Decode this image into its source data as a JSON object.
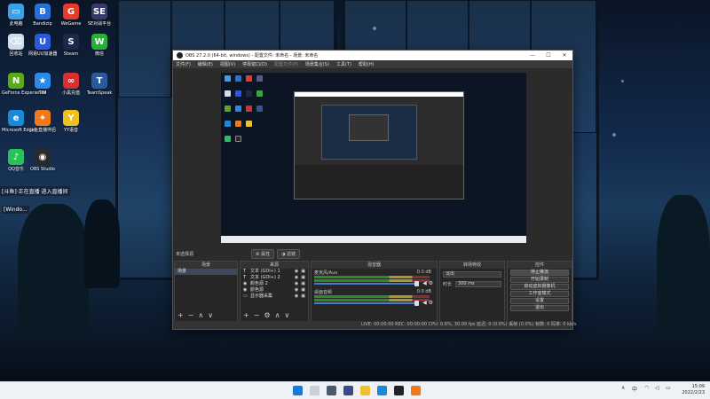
{
  "desktop": {
    "icons": [
      {
        "label": "此电脑",
        "color": "#3ca0e8",
        "glyph": "▭",
        "icon": "computer-icon"
      },
      {
        "label": "Bandizip",
        "color": "#2a6ed8",
        "glyph": "B",
        "icon": "bandizip-icon"
      },
      {
        "label": "WeGame",
        "color": "#e83a2a",
        "glyph": "G",
        "icon": "wegame-icon"
      },
      {
        "label": "SE对战平台",
        "color": "#3a3a6a",
        "glyph": "SE",
        "icon": "se-platform-icon"
      },
      {
        "label": "回收站",
        "color": "#cfdcea",
        "glyph": "⌫",
        "icon": "recycle-bin-icon"
      },
      {
        "label": "网易UU加速器",
        "color": "#2a5ad8",
        "glyph": "U",
        "icon": "uu-icon"
      },
      {
        "label": "Steam",
        "color": "#1b2a4a",
        "glyph": "S",
        "icon": "steam-icon"
      },
      {
        "label": "微信",
        "color": "#2aae3a",
        "glyph": "W",
        "icon": "wechat-icon"
      },
      {
        "label": "GeForce Experience",
        "color": "#5aaa1a",
        "glyph": "N",
        "icon": "geforce-icon"
      },
      {
        "label": "TIM",
        "color": "#2a8ae8",
        "glyph": "★",
        "icon": "tim-icon"
      },
      {
        "label": "小黑充值",
        "color": "#d83030",
        "glyph": "∞",
        "icon": "xiaohei-icon"
      },
      {
        "label": "TeamSpeak",
        "color": "#2a5a9a",
        "glyph": "T",
        "icon": "teamspeak-icon"
      },
      {
        "label": "Microsoft Edge",
        "color": "#1a8ad8",
        "glyph": "e",
        "icon": "edge-icon"
      },
      {
        "label": "斗鱼直播伴侣",
        "color": "#f07a1a",
        "glyph": "✦",
        "icon": "douyu-icon"
      },
      {
        "label": "YY语音",
        "color": "#f0c020",
        "glyph": "Y",
        "icon": "yy-icon"
      },
      {
        "label": "QQ音乐",
        "color": "#2ac05a",
        "glyph": "♪",
        "icon": "qqmusic-icon"
      },
      {
        "label": "OBS Studio",
        "color": "#2a2a2a",
        "glyph": "◉",
        "icon": "obs-icon"
      }
    ],
    "notif1": "[斗鱼]·正在直播 进入直播间",
    "notif2": "[Windo..."
  },
  "obs": {
    "title": "OBS 27.2.0 (64-bit, windows) - 配置文件: 未命名 - 场景: 未命名",
    "menu": [
      "文件(F)",
      "编辑(E)",
      "视图(V)",
      "停靠窗口(D)",
      "配置文件(P)",
      "场景集合(S)",
      "工具(T)",
      "帮助(H)"
    ],
    "scene_label": "未选择源",
    "prop_btn": "属性",
    "filter_btn": "滤镜",
    "docks": {
      "scenes": {
        "title": "场景",
        "items": [
          "场景"
        ]
      },
      "sources": {
        "title": "来源",
        "items": [
          "文本 (GDI+) 1",
          "文本 (GDI+) 2",
          "颜色源 2",
          "颜色源",
          "显示器采集"
        ]
      },
      "mixer": {
        "title": "混音器",
        "channels": [
          {
            "name": "麦克风/Aux",
            "db": "0.0 dB"
          },
          {
            "name": "桌面音频",
            "db": "0.0 dB"
          }
        ]
      },
      "transitions": {
        "title": "转场特效",
        "type": "淡出",
        "duration_label": "时长",
        "duration": "300 ms"
      },
      "controls": {
        "title": "控件",
        "buttons": [
          "停止推流",
          "开始录制",
          "启动虚拟摄像机",
          "工作室模式",
          "设置",
          "退出"
        ]
      }
    },
    "status": "LIVE: 00:00:00  REC: 00:00:00  CPU: 0.6%, 30.00 fps    延迟: 0 (0.0%)  丢帧 (0.0%)  帧数: 0  码率: 0 kb/s"
  },
  "taskbar": {
    "time": "15:09",
    "date": "2022/2/23",
    "lang": "中"
  }
}
